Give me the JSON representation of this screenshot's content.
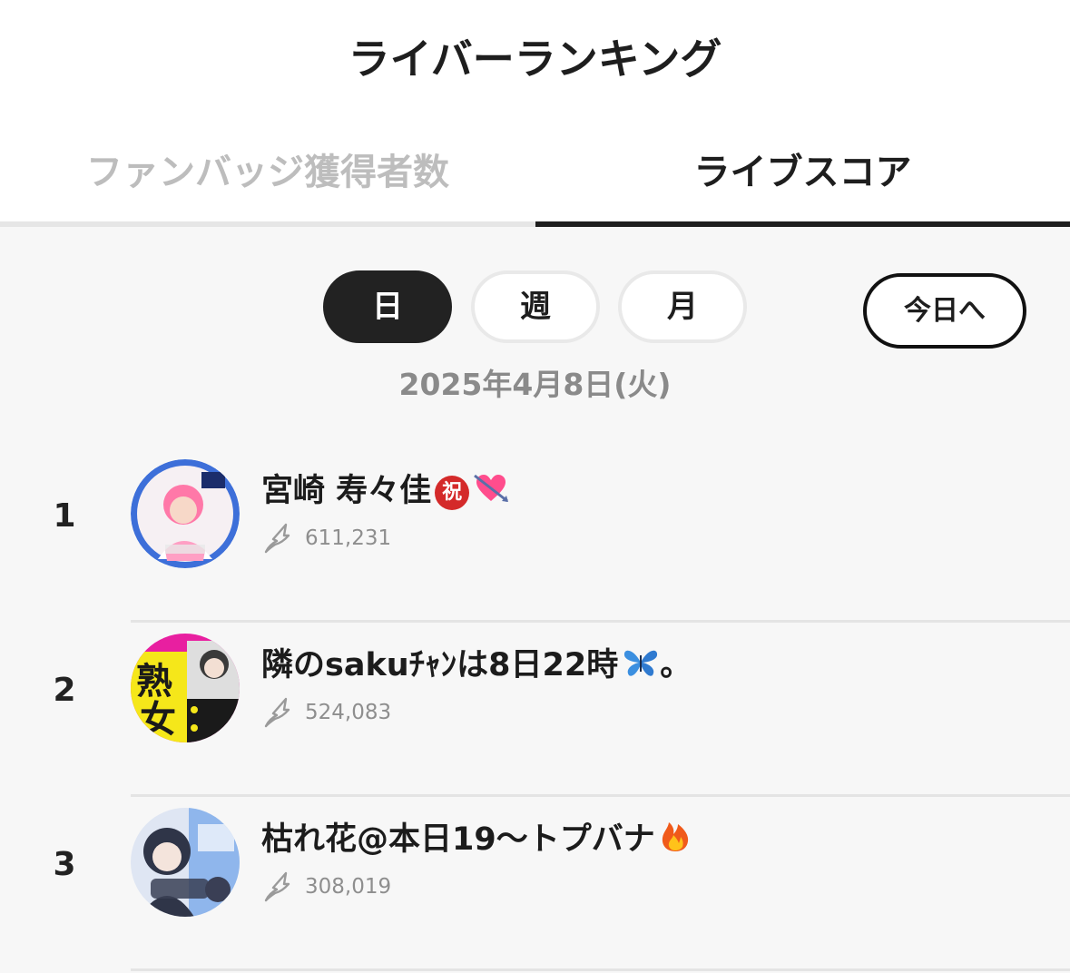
{
  "header": {
    "title": "ライバーランキング"
  },
  "tabs": [
    {
      "label": "ファンバッジ獲得者数",
      "active": false
    },
    {
      "label": "ライブスコア",
      "active": true
    }
  ],
  "period": {
    "options": [
      "日",
      "週",
      "月"
    ],
    "selected": "日",
    "today_button": "今日へ"
  },
  "date": "2025年4月8日(火)",
  "ranking": [
    {
      "rank": "1",
      "name": "宮崎 寿々佳",
      "badges": [
        "congratulation-badge-icon",
        "heart-with-arrow-icon"
      ],
      "badge_text": "祝",
      "score": "611,231",
      "avatar_colors": [
        "#3d6fd9",
        "#ff9fc4"
      ]
    },
    {
      "rank": "2",
      "name": "隣のsakuﾁｬﾝは8日22時",
      "badges": [
        "butterfly-icon"
      ],
      "suffix": "。",
      "score": "524,083",
      "avatar_colors": [
        "#e81fa0",
        "#f5e71a"
      ]
    },
    {
      "rank": "3",
      "name": "枯れ花@本日19〜トプバナ",
      "badges": [
        "fire-icon"
      ],
      "score": "308,019",
      "avatar_colors": [
        "#8fb6ec",
        "#2f3548"
      ]
    }
  ],
  "colors": {
    "accent": "#1e1e1e",
    "background": "#f7f7f7",
    "muted_text": "#8e8e8e",
    "inactive_tab": "#bdbdbd"
  }
}
